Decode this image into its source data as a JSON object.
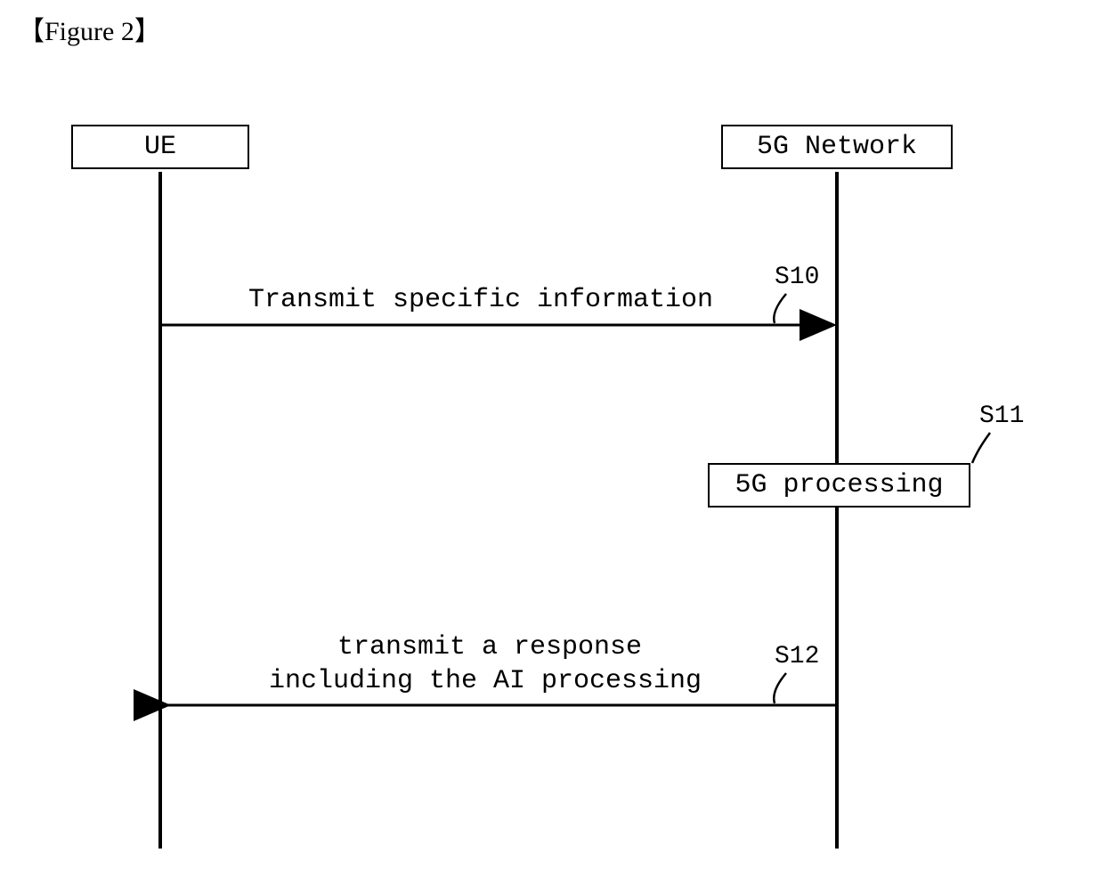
{
  "figure_title": "【Figure 2】",
  "actors": {
    "left": "UE",
    "right": "5G Network"
  },
  "processing_box": "5G processing",
  "messages": {
    "m1": {
      "text": "Transmit specific information",
      "step": "S10"
    },
    "m2": {
      "line1": "transmit a response",
      "line2": "including the AI processing",
      "step": "S12"
    }
  },
  "processing_step": "S11"
}
